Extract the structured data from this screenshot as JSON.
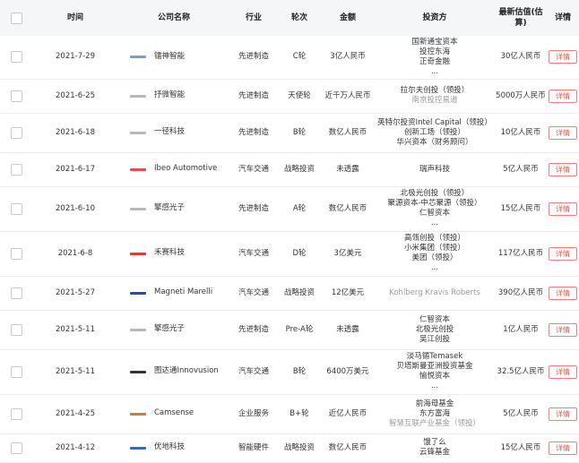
{
  "table": {
    "headers": {
      "time": "时间",
      "company": "公司名称",
      "industry": "行业",
      "round": "轮次",
      "amount": "金额",
      "investors": "投资方",
      "valuation": "最新估值(估算)",
      "detail": "详情"
    },
    "detail_label": "详情",
    "rows": [
      {
        "date": "2021-7-29",
        "company": "镭神智能",
        "logo": "lidar-logo-icon",
        "logo_color": "#7a9cc6",
        "industry": "先进制造",
        "round": "C轮",
        "amount": "3亿人民币",
        "investors": [
          {
            "text": "国新通宝资本"
          },
          {
            "text": "投控东海"
          },
          {
            "text": "正奇金融"
          },
          {
            "text": "..."
          }
        ],
        "valuation": "30亿人民币",
        "height": 48
      },
      {
        "date": "2021-6-25",
        "company": "抒微智能",
        "logo": "robot-logo-icon",
        "logo_color": "#b8b8b8",
        "industry": "先进制造",
        "round": "天使轮",
        "amount": "近千万人民币",
        "investors": [
          {
            "text": "拉尔夫创投（领投）"
          },
          {
            "text": "南京投控易道",
            "muted": true
          }
        ],
        "valuation": "5000万人民币",
        "height": 38
      },
      {
        "date": "2021-6-18",
        "company": "一径科技",
        "logo": "lidar-logo-icon",
        "logo_color": "#b8b8b8",
        "industry": "先进制造",
        "round": "B轮",
        "amount": "数亿人民币",
        "investors": [
          {
            "text": "英特尔投资Intel Capital（领投）"
          },
          {
            "text": "创新工场（领投）"
          },
          {
            "text": "华兴资本（财务顾问）"
          }
        ],
        "valuation": "10亿人民币",
        "height": 44
      },
      {
        "date": "2021-6-17",
        "company": "Ibeo Automotive",
        "logo": "ibeo-logo-icon",
        "logo_color": "#e05050",
        "industry": "汽车交通",
        "round": "战略投资",
        "amount": "未透露",
        "investors": [
          {
            "text": "瑞声科技"
          }
        ],
        "valuation": "5亿人民币",
        "height": 38
      },
      {
        "date": "2021-6-10",
        "company": "擎感光子",
        "logo": "photon-logo-icon",
        "logo_color": "#b8b8b8",
        "industry": "先进制造",
        "round": "A轮",
        "amount": "数亿人民币",
        "investors": [
          {
            "text": "北极光创投（领投）"
          },
          {
            "text": "聚源资本-中芯聚源（领投）"
          },
          {
            "text": "仁智资本"
          },
          {
            "text": "..."
          }
        ],
        "valuation": "15亿人民币",
        "height": 50
      },
      {
        "date": "2021-6-8",
        "company": "禾赛科技",
        "logo": "hesai-logo-icon",
        "logo_color": "#d04040",
        "industry": "汽车交通",
        "round": "D轮",
        "amount": "3亿美元",
        "investors": [
          {
            "text": "高瓴创投（领投）"
          },
          {
            "text": "小米集团（领投）"
          },
          {
            "text": "美团（领投）"
          },
          {
            "text": "..."
          }
        ],
        "valuation": "117亿人民币",
        "height": 50
      },
      {
        "date": "2021-5-27",
        "company": "Magneti Marelli",
        "logo": "marelli-logo-icon",
        "logo_color": "#2d4f8f",
        "industry": "汽车交通",
        "round": "战略投资",
        "amount": "12亿美元",
        "investors": [
          {
            "text": "Kohlberg Kravis Roberts",
            "muted": true
          }
        ],
        "valuation": "390亿人民币",
        "height": 38
      },
      {
        "date": "2021-5-11",
        "company": "擎感光子",
        "logo": "photon-logo-icon",
        "logo_color": "#b8b8b8",
        "industry": "先进制造",
        "round": "Pre-A轮",
        "amount": "未透露",
        "investors": [
          {
            "text": "仁智资本"
          },
          {
            "text": "北极光创投"
          },
          {
            "text": "吴江创投"
          }
        ],
        "valuation": "1亿人民币",
        "height": 44
      },
      {
        "date": "2021-5-11",
        "company": "图达通Innovusion",
        "logo": "innovusion-logo-icon",
        "logo_color": "#333333",
        "industry": "汽车交通",
        "round": "B轮",
        "amount": "6400万美元",
        "investors": [
          {
            "text": "淡马锡Temasek"
          },
          {
            "text": "贝塔斯曼亚洲投资基金"
          },
          {
            "text": "愉悦资本"
          },
          {
            "text": "..."
          }
        ],
        "valuation": "32.5亿人民币",
        "height": 50
      },
      {
        "date": "2021-4-25",
        "company": "Camsense",
        "logo": "camsense-logo-icon",
        "logo_color": "#e07050",
        "industry": "企业服务",
        "round": "B+轮",
        "amount": "近亿人民币",
        "investors": [
          {
            "text": "前海母基金"
          },
          {
            "text": "东方富海"
          },
          {
            "text": "智慧互联产业基金（领投）",
            "muted": true
          }
        ],
        "valuation": "5亿人民币",
        "height": 44
      },
      {
        "date": "2021-4-12",
        "company": "优地科技",
        "logo": "youdi-logo-icon",
        "logo_color": "#1e6fd9",
        "industry": "智能硬件",
        "round": "战略投资",
        "amount": "数亿人民币",
        "investors": [
          {
            "text": "饿了么"
          },
          {
            "text": "云锋基金"
          }
        ],
        "valuation": "15亿人民币",
        "height": 32
      }
    ]
  }
}
